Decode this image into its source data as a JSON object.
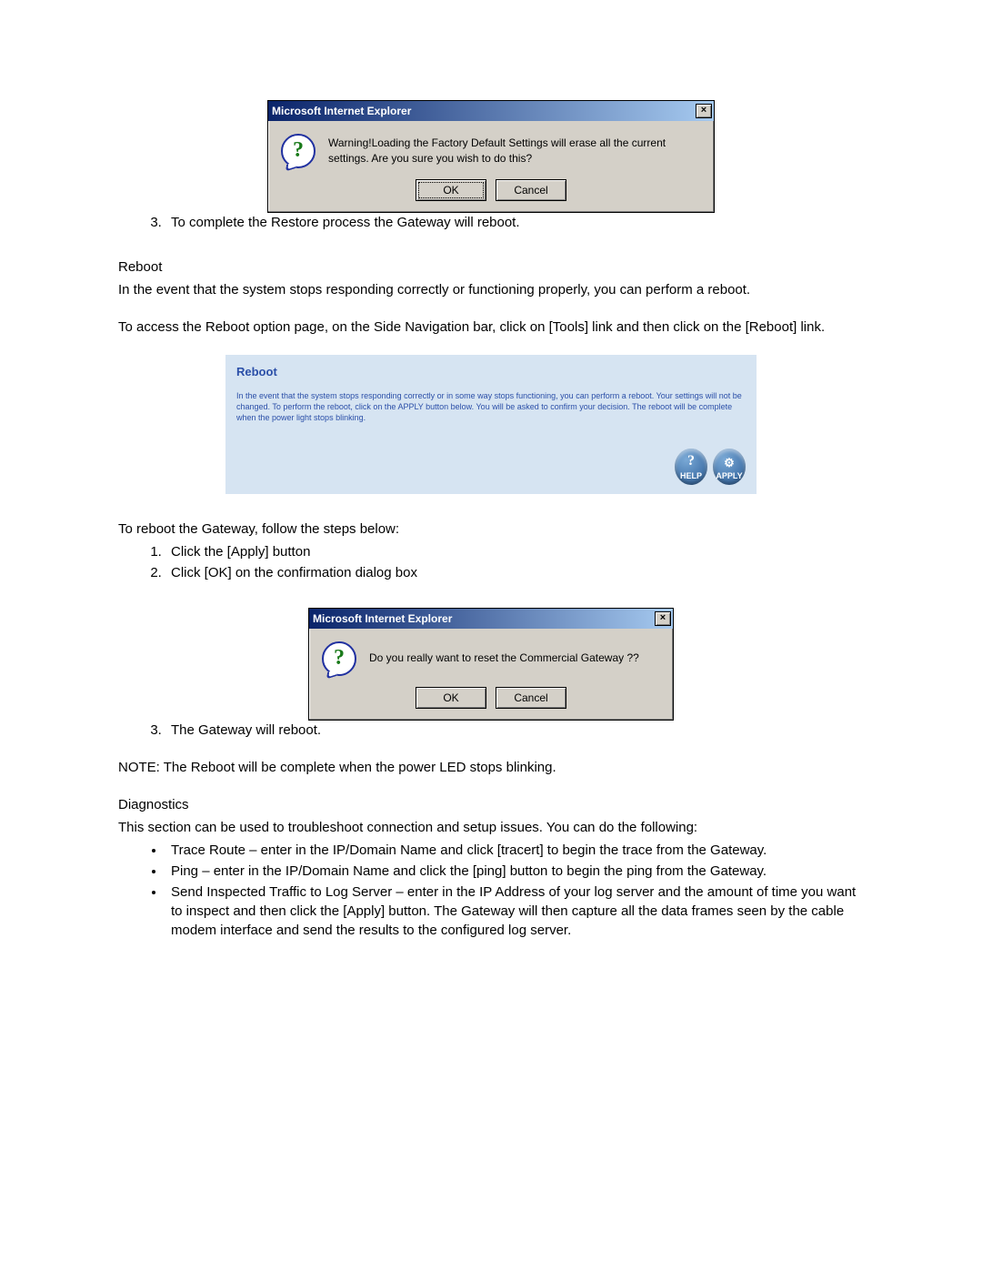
{
  "dialog1": {
    "title": "Microsoft Internet Explorer",
    "close": "×",
    "question": "?",
    "message": "Warning!Loading the Factory Default Settings will erase all the current settings. Are you sure you wish to do this?",
    "ok": "OK",
    "cancel": "Cancel"
  },
  "step3a": "To complete the Restore process the Gateway will reboot.",
  "reboot_heading": "Reboot",
  "reboot_intro": "In the event that the system stops responding correctly or functioning properly, you can perform a reboot.",
  "reboot_access": "To access the Reboot option page, on the Side Navigation bar, click on [Tools] link and then click on the [Reboot] link.",
  "panel": {
    "title": "Reboot",
    "body": "In the event that the system stops responding correctly or in some way stops functioning, you can perform a reboot. Your settings will not be changed. To perform the reboot, click on the APPLY button below. You will be asked to confirm your decision. The reboot will be complete when the power light stops blinking.",
    "help_q": "?",
    "help": "HELP",
    "apply": "APPLY"
  },
  "reboot_steps_lead": "To reboot the Gateway, follow the steps below:",
  "rsteps": {
    "s1": "Click the [Apply] button",
    "s2": "Click [OK] on the confirmation dialog box"
  },
  "dialog2": {
    "title": "Microsoft Internet Explorer",
    "close": "×",
    "question": "?",
    "message": "Do you really want to reset the Commercial Gateway ??",
    "ok": "OK",
    "cancel": "Cancel"
  },
  "step3b": "The Gateway will reboot.",
  "note": "NOTE: The Reboot will be complete when the power LED stops blinking.",
  "diag_heading": "Diagnostics",
  "diag_intro": "This section can be used to troubleshoot connection and setup issues. You can do the following:",
  "diag": {
    "b1": "Trace Route – enter in the IP/Domain Name and click [tracert] to begin the trace from the Gateway.",
    "b2": "Ping – enter in the IP/Domain Name and click the [ping] button to begin the ping from the Gateway.",
    "b3": "Send Inspected Traffic to Log Server – enter in the IP Address of your log server and the amount of time you want to inspect and then click the [Apply] button.  The Gateway will then capture all the data frames seen by the cable modem interface and send the results to the configured log server."
  }
}
